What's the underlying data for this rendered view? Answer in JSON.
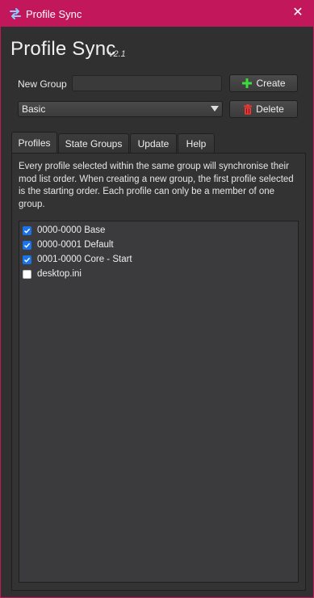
{
  "window": {
    "title": "Profile Sync",
    "close_glyph": "✕",
    "accent": "#c2185b"
  },
  "header": {
    "title": "Profile Sync",
    "version": "v2.1"
  },
  "new_group": {
    "label": "New Group",
    "value": "",
    "placeholder": ""
  },
  "buttons": {
    "create": "Create",
    "delete": "Delete"
  },
  "group_select": {
    "selected": "Basic"
  },
  "tabs": [
    {
      "label": "Profiles",
      "active": true
    },
    {
      "label": "State Groups",
      "active": false
    },
    {
      "label": "Update",
      "active": false
    },
    {
      "label": "Help",
      "active": false
    }
  ],
  "profiles_tab": {
    "description": "Every profile selected within the same group will synchronise their mod list order. When creating a new group, the first profile selected is the starting order. Each profile can only be a member of one group.",
    "profiles": [
      {
        "name": "0000-0000 Base",
        "checked": true
      },
      {
        "name": "0000-0001 Default",
        "checked": true
      },
      {
        "name": "0001-0000 Core - Start",
        "checked": true
      },
      {
        "name": "desktop.ini",
        "checked": false
      }
    ]
  },
  "icons": {
    "app": "sync-arrows-icon",
    "create": "plus-icon",
    "delete": "trash-icon",
    "dropdown": "chevron-down-icon",
    "close": "close-icon"
  }
}
